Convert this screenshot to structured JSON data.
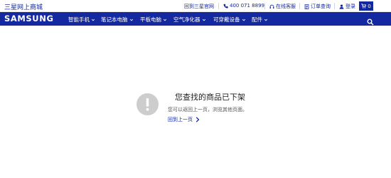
{
  "topbar": {
    "site_title": "三星网上商城",
    "links": [
      {
        "label": "回到三星官网",
        "icon": "external-link-icon"
      },
      {
        "label": "400 071 8899",
        "icon": "phone-icon"
      },
      {
        "label": "在线客服",
        "icon": "headset-icon"
      },
      {
        "label": "订单查询",
        "icon": "order-icon"
      },
      {
        "label": "登录",
        "icon": "user-icon"
      }
    ],
    "cart": {
      "count": "0",
      "icon": "cart-icon"
    }
  },
  "nav": {
    "brand": "SAMSUNG",
    "items": [
      {
        "label": "智能手机"
      },
      {
        "label": "笔记本电脑"
      },
      {
        "label": "平板电脑"
      },
      {
        "label": "空气净化器"
      },
      {
        "label": "可穿戴设备"
      },
      {
        "label": "配件"
      }
    ],
    "search_icon": "search-icon"
  },
  "empty_state": {
    "icon": "alert-icon",
    "title": "您查找的商品已下架",
    "description": "您可以返回上一页，浏览其他页面。",
    "back_link": "回到上一页"
  },
  "colors": {
    "brand_blue": "#1428a0",
    "icon_gray": "#cdcdcd"
  }
}
